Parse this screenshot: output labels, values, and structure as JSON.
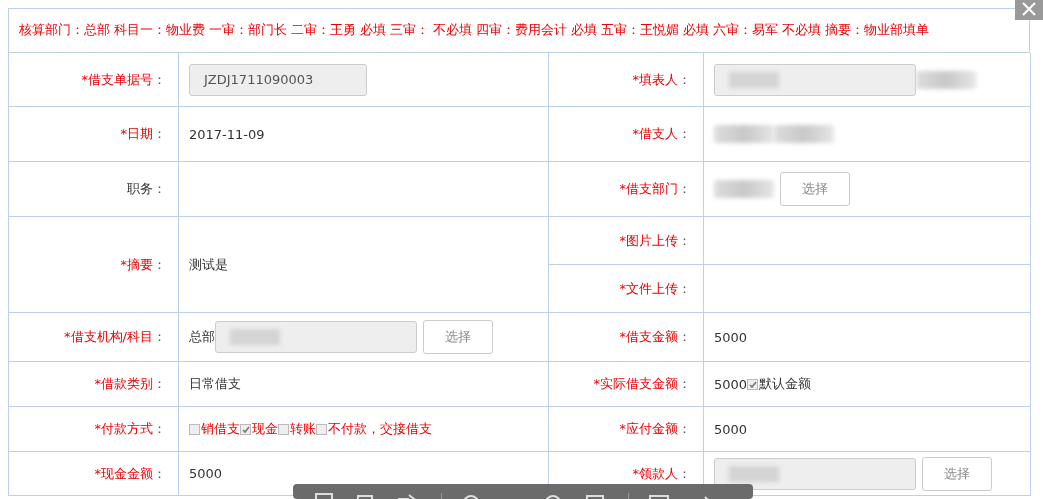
{
  "notice": "核算部门：总部 科目一：物业费 一审：部门长 二审：王勇 必填 三审： 不必填 四审：费用会计 必填 五审：王悦媚 必填 六审：易军 不必填 摘要：物业部填单",
  "rows": [
    {
      "left": {
        "label": "*借支单据号",
        "colon": "：",
        "required": true,
        "parts": [
          {
            "kind": "field",
            "value": "JZDJ1711090003"
          }
        ]
      },
      "right": [
        {
          "label": "*填表人",
          "colon": "：",
          "required": true,
          "parts": [
            {
              "kind": "redacted-field"
            },
            {
              "kind": "blur"
            }
          ]
        }
      ]
    },
    {
      "left": {
        "label": "*日期",
        "colon": "：",
        "required": true,
        "parts": [
          {
            "kind": "text",
            "value": "2017-11-09"
          }
        ]
      },
      "right": [
        {
          "label": "*借支人",
          "colon": "：",
          "required": true,
          "parts": [
            {
              "kind": "blur"
            },
            {
              "kind": "blur"
            }
          ]
        }
      ]
    },
    {
      "left": {
        "label": "职务",
        "colon": "：",
        "required": false
      },
      "right": [
        {
          "label": "*借支部门",
          "colon": "：",
          "required": true,
          "parts": [
            {
              "kind": "blur"
            },
            {
              "kind": "button",
              "label": "选择"
            }
          ]
        }
      ]
    },
    {
      "left": {
        "label": "*摘要",
        "colon": "：",
        "required": true,
        "parts": [
          {
            "kind": "text",
            "value": "测试是"
          }
        ]
      },
      "right": [
        {
          "label": "*图片上传",
          "colon": "：",
          "required": true
        },
        {
          "label": "*文件上传",
          "colon": "：",
          "required": true
        }
      ]
    },
    {
      "left": {
        "label": "*借支机构/科目",
        "colon": "：",
        "required": true,
        "parts": [
          {
            "kind": "text",
            "value": "总部"
          },
          {
            "kind": "redacted-field"
          },
          {
            "kind": "button",
            "label": "选择"
          }
        ]
      },
      "right": [
        {
          "label": "*借支金额",
          "colon": "：",
          "required": true,
          "parts": [
            {
              "kind": "text",
              "value": "5000"
            }
          ]
        }
      ]
    },
    {
      "left": {
        "label": "*借款类别",
        "colon": "：",
        "required": true,
        "parts": [
          {
            "kind": "text",
            "value": "日常借支"
          }
        ]
      },
      "right": [
        {
          "label": "*实际借支金额",
          "colon": "：",
          "required": true,
          "parts": [
            {
              "kind": "text",
              "value": "5000"
            },
            {
              "kind": "checkbox",
              "checked": true,
              "label": "默认金额",
              "warning": false
            }
          ]
        }
      ]
    },
    {
      "left": {
        "label": "*付款方式",
        "colon": "：",
        "required": true,
        "parts": [
          {
            "kind": "checkbox",
            "checked": false,
            "label": "销借支",
            "warning": true
          },
          {
            "kind": "checkbox",
            "checked": true,
            "label": "现金",
            "warning": true
          },
          {
            "kind": "checkbox",
            "checked": false,
            "label": "转账",
            "warning": true
          },
          {
            "kind": "checkbox",
            "checked": false,
            "label": "不付款，交接借支",
            "warning": true
          }
        ]
      },
      "right": [
        {
          "label": "*应付金额",
          "colon": "：",
          "required": true,
          "parts": [
            {
              "kind": "text",
              "value": "5000"
            }
          ]
        }
      ]
    },
    {
      "left": {
        "label": "*现金金额",
        "colon": "：",
        "required": true,
        "parts": [
          {
            "kind": "text",
            "value": "5000"
          }
        ]
      },
      "right": [
        {
          "label": "*领款人",
          "colon": "：",
          "required": true,
          "parts": [
            {
              "kind": "redacted-field"
            },
            {
              "kind": "button",
              "label": "选择"
            }
          ]
        }
      ]
    }
  ]
}
